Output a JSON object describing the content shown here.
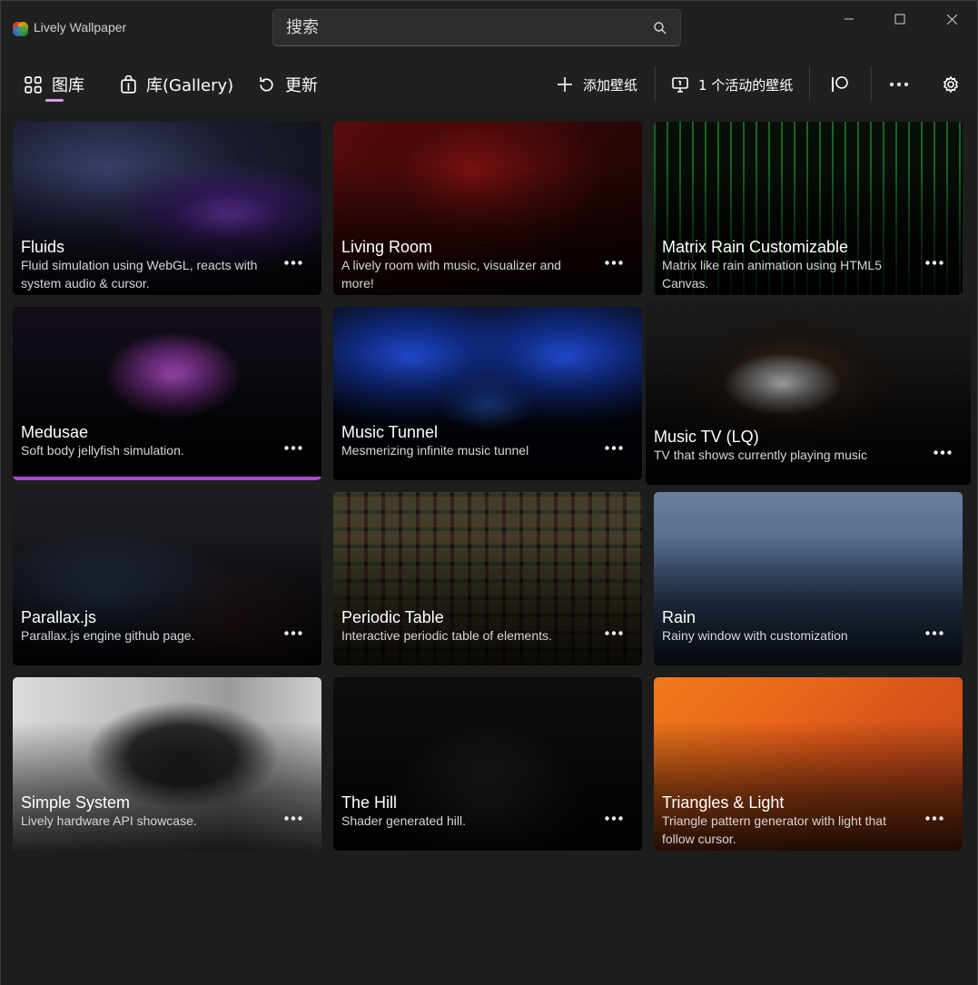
{
  "titlebar": {
    "app_title": "Lively Wallpaper",
    "search_placeholder": "搜索",
    "controls": [
      "minimize",
      "maximize",
      "close"
    ]
  },
  "nav": {
    "library_label": "图库",
    "gallery_label": "库(Gallery)",
    "update_label": "更新",
    "add_wallpaper_label": "添加壁纸",
    "active_wallpapers_label": "1 个活动的壁纸"
  },
  "colors": {
    "accent": "#d99ee8",
    "selected_bar": "#a14fc9",
    "background": "#202020"
  },
  "wallpapers": [
    {
      "title": "Fluids",
      "description": "Fluid simulation using WebGL, reacts with system audio & cursor."
    },
    {
      "title": "Living Room",
      "description": "A lively room with music, visualizer and more!"
    },
    {
      "title": "Matrix Rain Customizable",
      "description": "Matrix like rain animation using HTML5 Canvas."
    },
    {
      "title": "Medusae",
      "description": "Soft body jellyfish simulation.",
      "selected": true
    },
    {
      "title": "Music Tunnel",
      "description": "Mesmerizing infinite music tunnel"
    },
    {
      "title": "Music TV (LQ)",
      "description": "TV that shows currently playing music"
    },
    {
      "title": "Parallax.js",
      "description": "Parallax.js engine github page."
    },
    {
      "title": "Periodic Table",
      "description": "Interactive periodic table of elements."
    },
    {
      "title": "Rain",
      "description": "Rainy window with customization"
    },
    {
      "title": "Simple System",
      "description": "Lively hardware API showcase."
    },
    {
      "title": "The Hill",
      "description": "Shader generated hill."
    },
    {
      "title": "Triangles & Light",
      "description": "Triangle pattern generator with light that follow cursor."
    }
  ]
}
